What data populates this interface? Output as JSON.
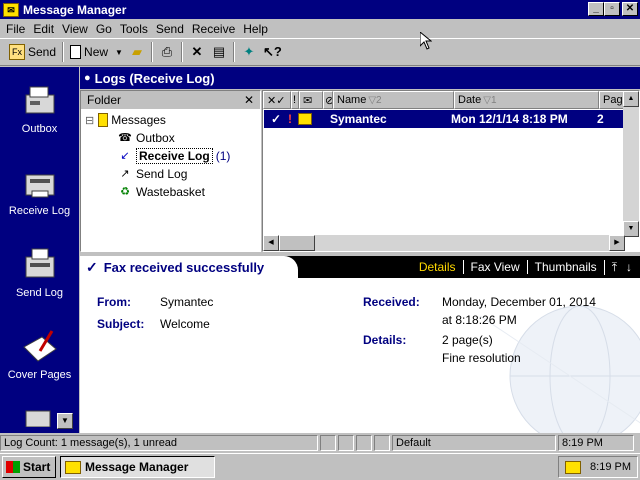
{
  "window": {
    "title": "Message Manager",
    "controls": {
      "minimize": "_",
      "maximize": "▫",
      "close": "✕"
    }
  },
  "menu": [
    "File",
    "Edit",
    "View",
    "Go",
    "Tools",
    "Send",
    "Receive",
    "Help"
  ],
  "toolbar": {
    "send_label": "Send",
    "new_label": "New"
  },
  "sidebar": {
    "items": [
      {
        "label": "Outbox",
        "icon": "fax-machine-icon"
      },
      {
        "label": "Receive Log",
        "icon": "receive-fax-icon"
      },
      {
        "label": "Send Log",
        "icon": "send-fax-icon"
      },
      {
        "label": "Cover Pages",
        "icon": "cover-pages-icon"
      }
    ]
  },
  "log_header": {
    "title": "Logs (Receive Log)"
  },
  "folder_pane": {
    "title": "Folder",
    "close": "✕",
    "tree": {
      "root": "Messages",
      "expander": "⊟",
      "children": [
        {
          "label": "Outbox",
          "count": ""
        },
        {
          "label": "Receive Log",
          "count": "(1)"
        },
        {
          "label": "Send Log",
          "count": ""
        },
        {
          "label": "Wastebasket",
          "count": ""
        }
      ]
    }
  },
  "message_list": {
    "columns": {
      "status": "✕✓",
      "priority": "!",
      "attachment": "⊘",
      "name": "Name",
      "name_sort": "▽2",
      "date": "Date",
      "date_sort": "▽1",
      "pages": "Page"
    },
    "rows": [
      {
        "name": "Symantec",
        "date": "Mon 12/1/14  8:18 PM",
        "pages": "2"
      }
    ]
  },
  "detail": {
    "status": "Fax received successfully",
    "links": {
      "details": "Details",
      "fax_view": "Fax View",
      "thumbnails": "Thumbnails"
    },
    "from_label": "From:",
    "from_value": "Symantec",
    "subject_label": "Subject:",
    "subject_value": "Welcome",
    "received_label": "Received:",
    "received_date": "Monday, December 01, 2014",
    "received_time": "at 8:18:26 PM",
    "details_label": "Details:",
    "details_pages": "2 page(s)",
    "details_resolution": "Fine resolution"
  },
  "status_bar": {
    "log_count": "Log Count: 1 message(s), 1 unread",
    "profile": "Default",
    "time": "8:19 PM"
  },
  "taskbar": {
    "start": "Start",
    "task": "Message Manager",
    "clock": "8:19 PM"
  },
  "colors": {
    "title_blue": "#000080",
    "face": "#c0c0c0",
    "accent_yellow": "#ffd800"
  }
}
